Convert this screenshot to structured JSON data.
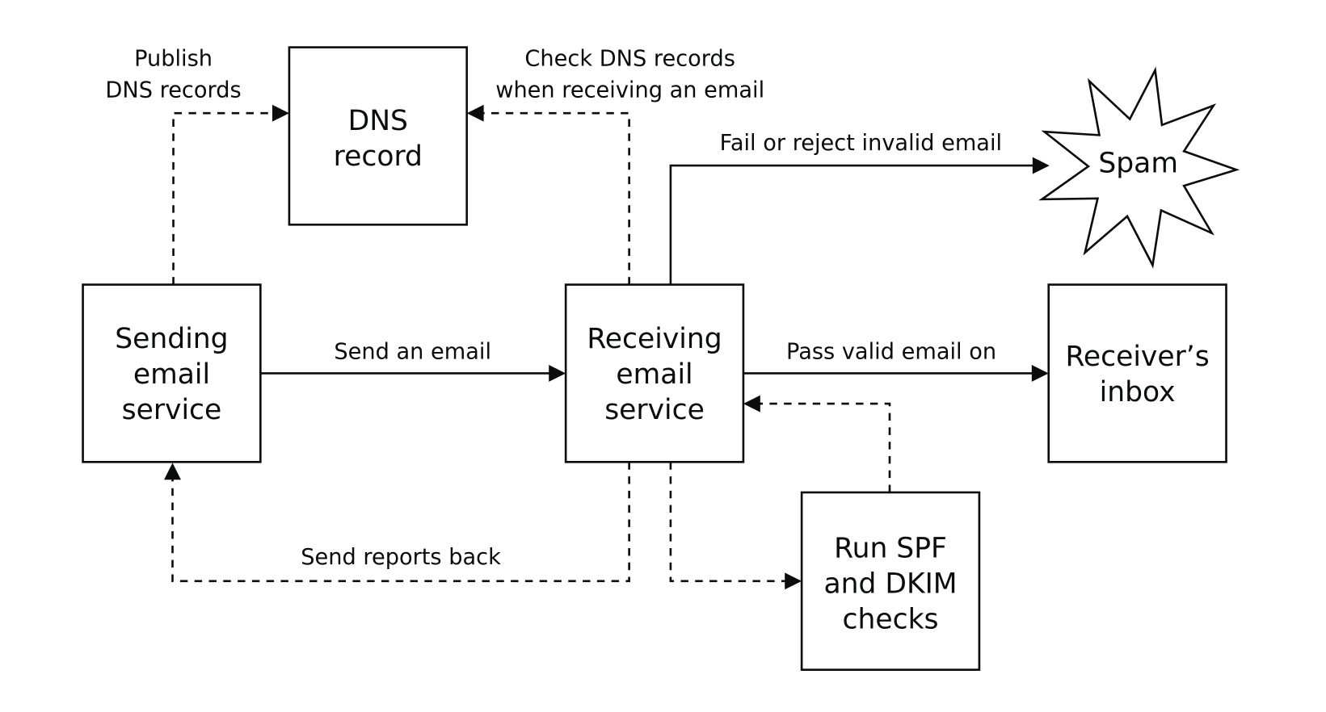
{
  "nodes": {
    "dns": {
      "line1": "DNS",
      "line2": "record"
    },
    "sending": {
      "line1": "Sending",
      "line2": "email",
      "line3": "service"
    },
    "receiving": {
      "line1": "Receiving",
      "line2": "email",
      "line3": "service"
    },
    "inbox": {
      "line1": "Receiver’s",
      "line2": "inbox"
    },
    "checks": {
      "line1": "Run SPF",
      "line2": "and DKIM",
      "line3": "checks"
    },
    "spam": {
      "label": "Spam"
    }
  },
  "edges": {
    "publish": {
      "line1": "Publish",
      "line2": "DNS records",
      "style": "dashed"
    },
    "check_dns": {
      "line1": "Check DNS records",
      "line2": "when receiving an email",
      "style": "dashed"
    },
    "fail": {
      "label": "Fail or reject invalid email",
      "style": "solid"
    },
    "send": {
      "label": "Send an email",
      "style": "solid"
    },
    "pass": {
      "label": "Pass valid email on",
      "style": "solid"
    },
    "reports": {
      "label": "Send reports back",
      "style": "dashed"
    },
    "to_checks": {
      "style": "dashed"
    },
    "from_checks": {
      "style": "dashed"
    }
  },
  "colors": {
    "stroke": "#0b0c0c",
    "background": "#ffffff"
  }
}
